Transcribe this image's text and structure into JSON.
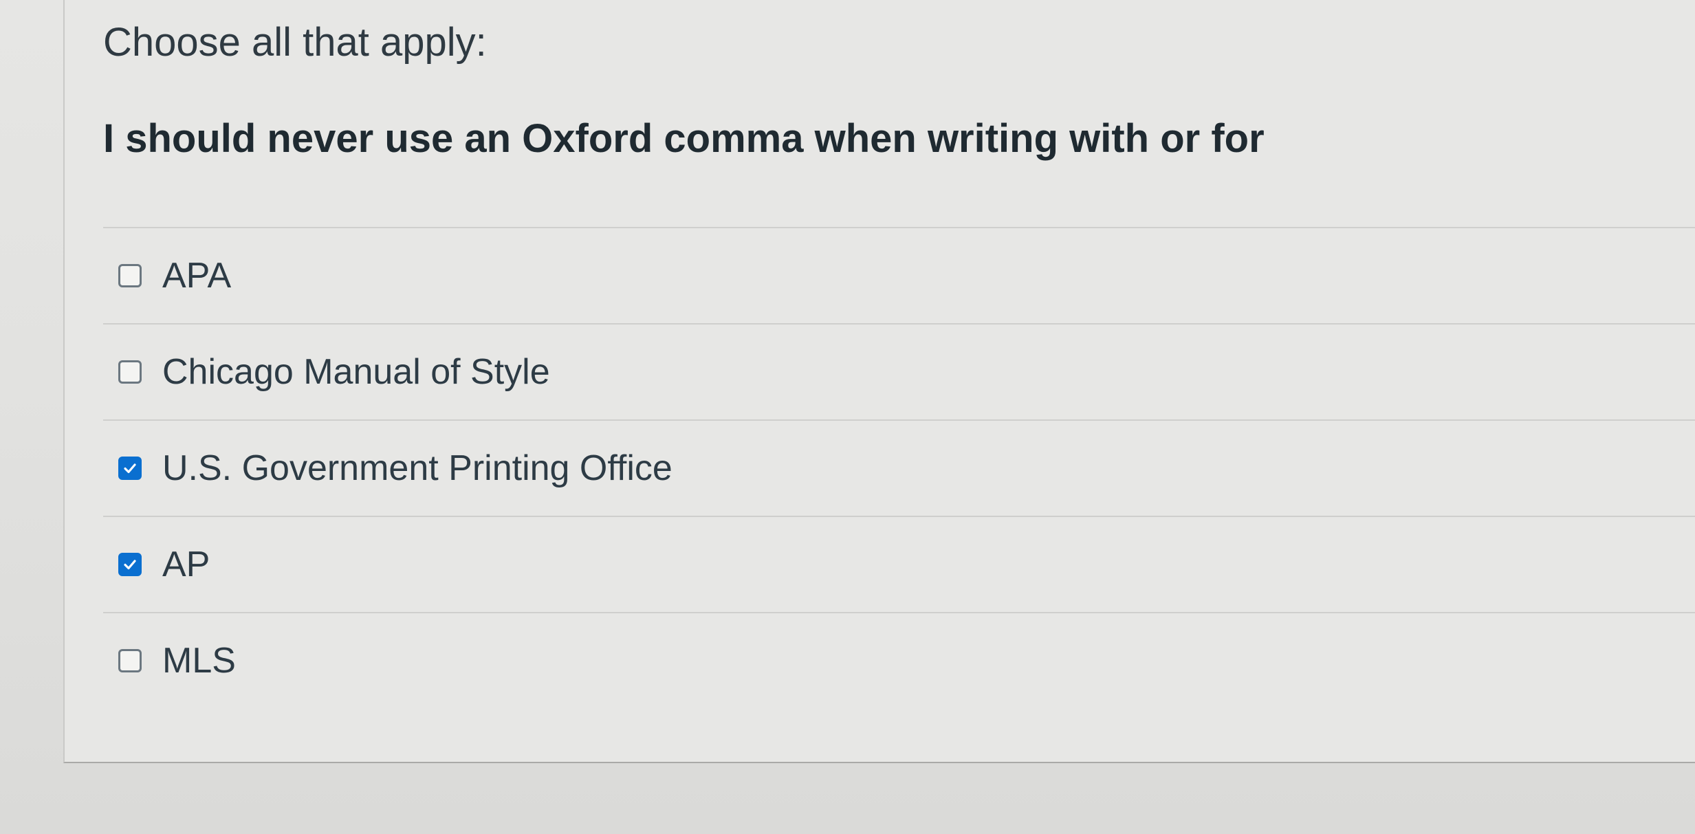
{
  "quiz": {
    "instructions": "Choose all that apply:",
    "question": "I should never use an Oxford comma when writing with or for",
    "answers": [
      {
        "label": "APA",
        "checked": false
      },
      {
        "label": "Chicago Manual of Style",
        "checked": false
      },
      {
        "label": "U.S. Government Printing Office",
        "checked": true
      },
      {
        "label": "AP",
        "checked": true
      },
      {
        "label": "MLS",
        "checked": false
      }
    ]
  },
  "colors": {
    "checkbox_checked": "#0a6fd0",
    "text": "#2d3b45"
  },
  "icons": {
    "checked": "checkmark-icon"
  }
}
